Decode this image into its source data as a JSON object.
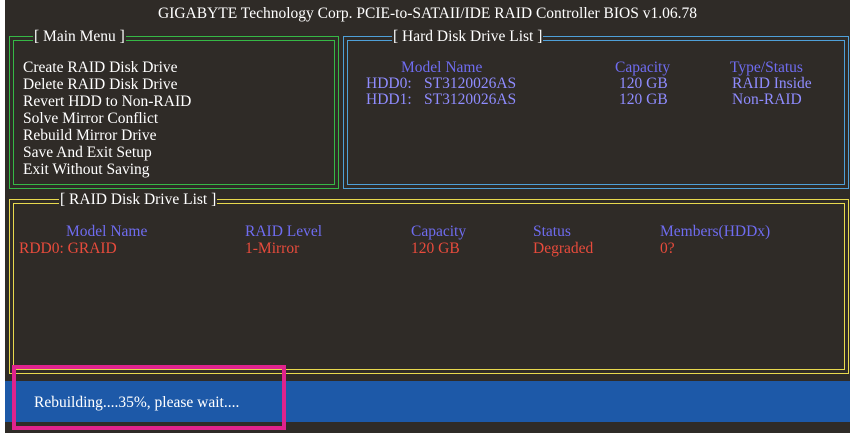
{
  "window": {
    "title": "GIGABYTE Technology Corp. PCIE-to-SATAII/IDE RAID Controller BIOS v1.06.78"
  },
  "main_menu": {
    "title": "[ Main Menu ]",
    "items": [
      "Create RAID Disk Drive",
      "Delete RAID Disk Drive",
      "Revert HDD to Non-RAID",
      "Solve Mirror Conflict",
      "Rebuild Mirror Drive",
      "Save And Exit Setup",
      "Exit Without Saving"
    ]
  },
  "hdd_list": {
    "title": "[ Hard Disk Drive List ]",
    "headers": {
      "model": "Model Name",
      "capacity": "Capacity",
      "type": "Type/Status"
    },
    "rows": [
      {
        "id": "HDD0:",
        "model": "ST3120026AS",
        "capacity": "120 GB",
        "type": "RAID Inside"
      },
      {
        "id": "HDD1:",
        "model": "ST3120026AS",
        "capacity": "120 GB",
        "type": "Non-RAID"
      }
    ]
  },
  "raid_list": {
    "title": "[ RAID Disk Drive List ]",
    "headers": {
      "model": "Model Name",
      "level": "RAID Level",
      "capacity": "Capacity",
      "status": "Status",
      "members": "Members(HDDx)"
    },
    "rows": [
      {
        "model": "RDD0: GRAID",
        "level": "1-Mirror",
        "capacity": "120 GB",
        "status": "Degraded",
        "members": "0?"
      }
    ]
  },
  "status_bar": {
    "text": "Rebuilding....35%, please wait...."
  },
  "colors": {
    "background": "#2f2b27",
    "main_border": "#36b846",
    "hdd_border": "#4fa0d8",
    "raid_border": "#e8d94e",
    "status_bar": "#1d59a8",
    "highlight": "#e0238d"
  }
}
